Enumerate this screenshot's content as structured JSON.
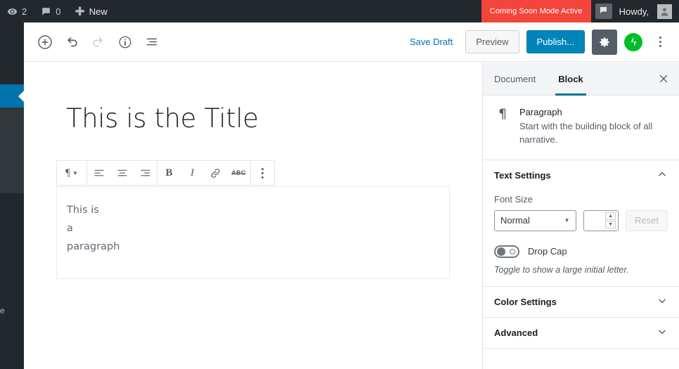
{
  "adminbar": {
    "site_icon": "wordpress-eye-icon",
    "updates_icon": "updates-icon",
    "updates_count": "2",
    "comments_icon": "comment-bubble-icon",
    "comments_count": "0",
    "new_icon": "plus-icon",
    "new_label": "New",
    "coming_soon_label": "Coming Soon Mode Active",
    "feedback_icon": "comment-bubble-icon",
    "howdy_label": "Howdy,",
    "avatar_icon": "user-avatar-icon"
  },
  "adminmenu": {
    "current_item_icon": "current-menu-arrow-icon",
    "stray_label": "e"
  },
  "editor_header": {
    "add_block_label": "add-block",
    "undo_label": "undo",
    "redo_label": "redo",
    "info_label": "content-structure",
    "block_nav_label": "block-navigation",
    "save_draft_label": "Save Draft",
    "preview_label": "Preview",
    "publish_label": "Publish...",
    "settings_label": "settings",
    "jetpack_label": "jetpack",
    "more_label": "more-options"
  },
  "canvas": {
    "title": "This is the Title",
    "paragraph_lines": [
      "This is",
      "a",
      "paragraph"
    ]
  },
  "block_toolbar": {
    "type_icon": "paragraph-pilcrow-icon",
    "align_left": "align-left",
    "align_center": "align-center",
    "align_right": "align-right",
    "bold": "B",
    "italic": "I",
    "link": "link-icon",
    "strikethrough": "ABC",
    "more": "more-rich-text-controls"
  },
  "settings": {
    "tabs": [
      {
        "label": "Document",
        "active": false
      },
      {
        "label": "Block",
        "active": true
      }
    ],
    "close_icon": "close-icon",
    "block_card": {
      "icon": "paragraph-pilcrow-icon",
      "title": "Paragraph",
      "description": "Start with the building block of all narrative."
    },
    "panels": [
      {
        "title": "Text Settings",
        "expanded": true,
        "chevron": "chevron-up-icon"
      },
      {
        "title": "Color Settings",
        "expanded": false,
        "chevron": "chevron-down-icon"
      },
      {
        "title": "Advanced",
        "expanded": false,
        "chevron": "chevron-down-icon"
      }
    ],
    "text_settings": {
      "font_size_label": "Font Size",
      "font_size_value": "Normal",
      "font_size_number": "",
      "reset_label": "Reset",
      "drop_cap_label": "Drop Cap",
      "drop_cap_on": false,
      "drop_cap_help": "Toggle to show a large initial letter."
    }
  },
  "colors": {
    "adminbar_bg": "#23282d",
    "menu_current": "#0073aa",
    "coming_soon_bg": "#f4453c",
    "publish_bg": "#0085ba",
    "jetpack_green": "#00be28",
    "tab_underline": "#00739c",
    "link_blue": "#0073aa"
  }
}
